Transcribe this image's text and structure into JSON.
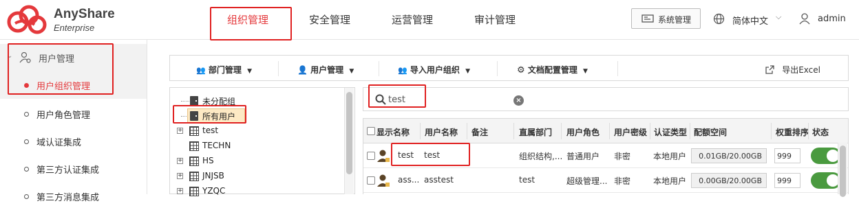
{
  "brand": {
    "name": "AnyShare",
    "edition": "Enterprise",
    "color": "#e4393c"
  },
  "nav": {
    "tabs": [
      {
        "label": "组织管理",
        "active": true
      },
      {
        "label": "安全管理"
      },
      {
        "label": "运营管理"
      },
      {
        "label": "审计管理"
      }
    ],
    "system_btn": "系统管理",
    "language": "简体中文",
    "user": "admin"
  },
  "sidebar": {
    "group_label": "用户管理",
    "items": [
      {
        "label": "用户组织管理",
        "active": true
      },
      {
        "label": "用户角色管理"
      },
      {
        "label": "域认证集成"
      },
      {
        "label": "第三方认证集成"
      },
      {
        "label": "第三方消息集成"
      }
    ]
  },
  "toolbar": {
    "dept": "部门管理",
    "user": "用户管理",
    "import": "导入用户组织",
    "docconfig": "文档配置管理",
    "export": "导出Excel"
  },
  "tree": [
    {
      "label": "未分配组",
      "icon": "door-icon"
    },
    {
      "label": "所有用户",
      "icon": "door-icon",
      "selected": true
    },
    {
      "label": "test",
      "icon": "grid-icon",
      "expandable": true
    },
    {
      "label": "TECHN",
      "icon": "grid-icon"
    },
    {
      "label": "HS",
      "icon": "grid-icon",
      "expandable": true
    },
    {
      "label": "JNJSB",
      "icon": "grid-icon",
      "expandable": true
    },
    {
      "label": "YZQC",
      "icon": "grid-icon",
      "expandable": true
    }
  ],
  "search": {
    "value": "test"
  },
  "table": {
    "columns": [
      "显示名称",
      "用户名称",
      "备注",
      "直属部门",
      "用户角色",
      "用户密级",
      "认证类型",
      "配额空间",
      "权重排序",
      "状态"
    ],
    "rows": [
      {
        "display": "test",
        "username": "test",
        "note": "",
        "dept": "组织结构,...",
        "role": "普通用户",
        "level": "非密",
        "auth": "本地用户",
        "quota": "0.01GB/20.00GB",
        "priority": "999",
        "enabled": true
      },
      {
        "display": "ass...",
        "username": "asstest",
        "note": "",
        "dept": "test",
        "role": "超级管理...",
        "level": "非密",
        "auth": "本地用户",
        "quota": "0.00GB/20.00GB",
        "priority": "999",
        "enabled": true
      }
    ]
  }
}
